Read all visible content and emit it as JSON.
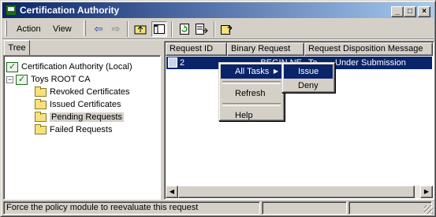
{
  "window": {
    "title": "Certification Authority"
  },
  "menubar": {
    "items": [
      "Action",
      "View"
    ]
  },
  "toolbar": {
    "buttons": [
      "back-icon",
      "forward-icon",
      "up-folder-icon",
      "show-hide-tree-icon",
      "refresh-icon",
      "export-list-icon",
      "help-icon"
    ]
  },
  "tree": {
    "tab_label": "Tree",
    "root": "Certification Authority (Local)",
    "ca_node": "Toys ROOT CA",
    "folders": [
      "Revoked Certificates",
      "Issued Certificates",
      "Pending Requests",
      "Failed Requests"
    ],
    "selected": "Pending Requests"
  },
  "list": {
    "columns": [
      "Request ID",
      "Binary Request",
      "Request Disposition Message"
    ],
    "rows": [
      {
        "request_id": "2",
        "binary_request": "-----BEGIN NE...",
        "disposition_prefix": "Ta",
        "disposition": "Under Submission"
      }
    ]
  },
  "context_menu": {
    "items": [
      "All Tasks",
      "Refresh",
      "Help"
    ],
    "highlighted": "All Tasks",
    "submenu": [
      "Issue",
      "Deny"
    ],
    "submenu_highlighted": "Issue"
  },
  "statusbar": {
    "message": "Force the policy module to reevaluate this request"
  },
  "colors": {
    "titlebar_start": "#0a246a",
    "titlebar_end": "#a6caf0",
    "selection": "#0a246a",
    "face": "#d4d0c8"
  }
}
